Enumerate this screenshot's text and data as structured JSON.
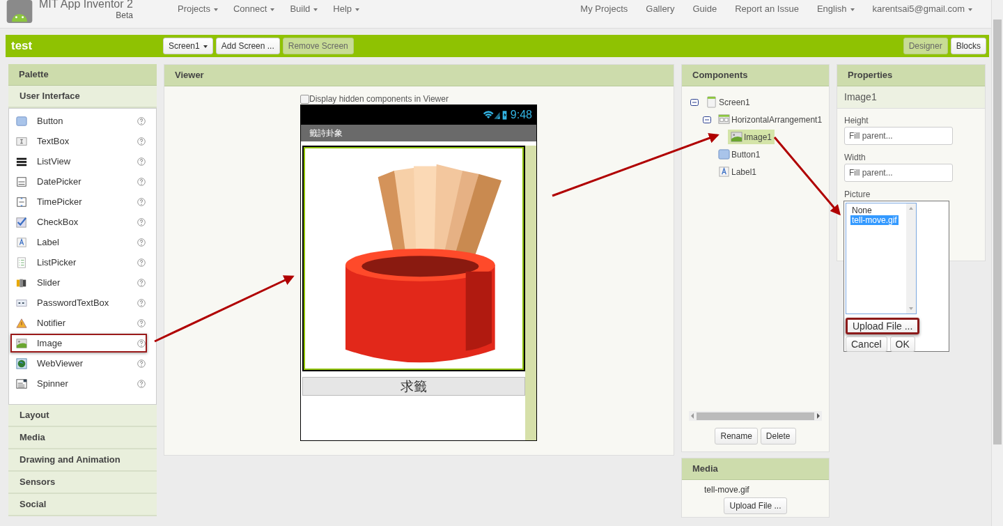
{
  "header": {
    "app_name": "MIT App Inventor 2",
    "edition": "Beta",
    "menus": [
      {
        "label": "Projects",
        "dropdown": true
      },
      {
        "label": "Connect",
        "dropdown": true
      },
      {
        "label": "Build",
        "dropdown": true
      },
      {
        "label": "Help",
        "dropdown": true
      }
    ],
    "links": [
      {
        "label": "My Projects",
        "dropdown": false
      },
      {
        "label": "Gallery",
        "dropdown": false
      },
      {
        "label": "Guide",
        "dropdown": false
      },
      {
        "label": "Report an Issue",
        "dropdown": false
      },
      {
        "label": "English",
        "dropdown": true
      },
      {
        "label": "karentsai5@gmail.com",
        "dropdown": true
      }
    ]
  },
  "toolbar": {
    "project": "test",
    "buttons": [
      {
        "label": "Screen1",
        "dropdown": true,
        "disabled": false
      },
      {
        "label": "Add Screen ...",
        "dropdown": false,
        "disabled": false
      },
      {
        "label": "Remove Screen",
        "dropdown": false,
        "disabled": true
      }
    ],
    "views": [
      {
        "label": "Designer",
        "selected": true
      },
      {
        "label": "Blocks",
        "selected": false
      }
    ]
  },
  "palette": {
    "title": "Palette",
    "categories": [
      {
        "label": "User Interface",
        "items": [
          {
            "name": "Button",
            "kind": "button",
            "highlighted": false
          },
          {
            "name": "TextBox",
            "kind": "textbox",
            "highlighted": false
          },
          {
            "name": "ListView",
            "kind": "listview",
            "highlighted": false
          },
          {
            "name": "DatePicker",
            "kind": "datepicker",
            "highlighted": false
          },
          {
            "name": "TimePicker",
            "kind": "timepicker",
            "highlighted": false
          },
          {
            "name": "CheckBox",
            "kind": "checkbox",
            "highlighted": false
          },
          {
            "name": "Label",
            "kind": "label",
            "highlighted": false
          },
          {
            "name": "ListPicker",
            "kind": "listpicker",
            "highlighted": false
          },
          {
            "name": "Slider",
            "kind": "slider",
            "highlighted": false
          },
          {
            "name": "PasswordTextBox",
            "kind": "password",
            "highlighted": false
          },
          {
            "name": "Notifier",
            "kind": "notifier",
            "highlighted": false
          },
          {
            "name": "Image",
            "kind": "image",
            "highlighted": true
          },
          {
            "name": "WebViewer",
            "kind": "webviewer",
            "highlighted": false
          },
          {
            "name": "Spinner",
            "kind": "spinner",
            "highlighted": false
          }
        ]
      },
      {
        "label": "Layout"
      },
      {
        "label": "Media"
      },
      {
        "label": "Drawing and Animation"
      },
      {
        "label": "Sensors"
      },
      {
        "label": "Social"
      }
    ]
  },
  "viewer": {
    "title": "Viewer",
    "hidden_toggle": {
      "label": "Display hidden components in Viewer",
      "checked": false
    },
    "phone": {
      "time": "9:48",
      "screen_title": "籤詩卦象",
      "button_label": "求籤"
    }
  },
  "components": {
    "title": "Components",
    "tree": [
      {
        "name": "Screen1",
        "kind": "screen",
        "expanded": true,
        "selected": false,
        "children": [
          {
            "name": "HorizontalArrangement1",
            "kind": "arrangement",
            "expanded": true,
            "selected": false,
            "children": [
              {
                "name": "Image1",
                "kind": "image",
                "selected": true
              }
            ]
          },
          {
            "name": "Button1",
            "kind": "button",
            "selected": false
          },
          {
            "name": "Label1",
            "kind": "label",
            "selected": false
          }
        ]
      }
    ],
    "buttons": [
      "Rename",
      "Delete"
    ]
  },
  "media": {
    "title": "Media",
    "files": [
      "tell-move.gif"
    ],
    "upload_button": "Upload File ..."
  },
  "properties": {
    "title": "Properties",
    "component": "Image1",
    "fields": [
      {
        "label": "Height",
        "value": "Fill parent..."
      },
      {
        "label": "Width",
        "value": "Fill parent..."
      }
    ],
    "picture": {
      "label": "Picture",
      "options": [
        {
          "label": "None",
          "selected": false
        },
        {
          "label": "tell-move.gif",
          "selected": true
        }
      ],
      "upload_button": {
        "label": "Upload File ...",
        "highlighted": true
      },
      "buttons": [
        "Cancel",
        "OK"
      ]
    }
  }
}
